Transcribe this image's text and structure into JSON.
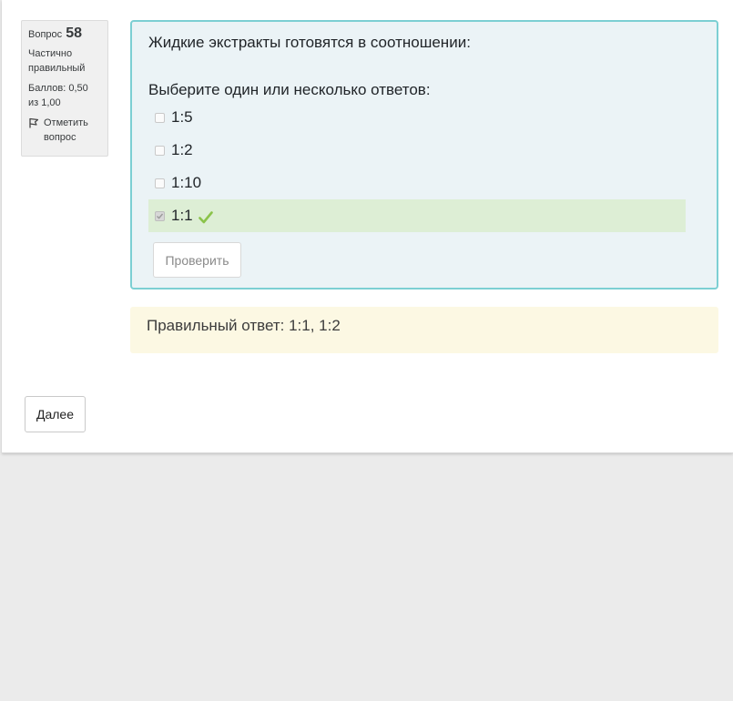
{
  "question_info": {
    "label": "Вопрос",
    "number": "58",
    "state": "Частично правильный",
    "grade": "Баллов: 0,50 из 1,00",
    "flag_label": "Отметить вопрос",
    "flag_icon": "flag-icon"
  },
  "question": {
    "text": "Жидкие экстракты готовятся в соотношении:",
    "prompt": "Выберите один или несколько ответов:",
    "options": [
      {
        "label": "1:5",
        "checked": false
      },
      {
        "label": "1:2",
        "checked": false
      },
      {
        "label": "1:10",
        "checked": false
      },
      {
        "label": "1:1",
        "checked": true,
        "correct": true
      }
    ],
    "check_button": "Проверить",
    "correct_icon": "checkmark-icon"
  },
  "feedback": {
    "right_answer": "Правильный ответ: 1:1, 1:2"
  },
  "navigation": {
    "next_button": "Далее"
  },
  "colors": {
    "question_bg": "#ebf3f6",
    "question_border": "#7ccfd3",
    "correct_bg": "#ddeed5",
    "correct_tick": "#8bc34a",
    "feedback_bg": "#fcf8e3",
    "info_bg": "#f0f0f0",
    "page_bg": "#ebebeb"
  }
}
